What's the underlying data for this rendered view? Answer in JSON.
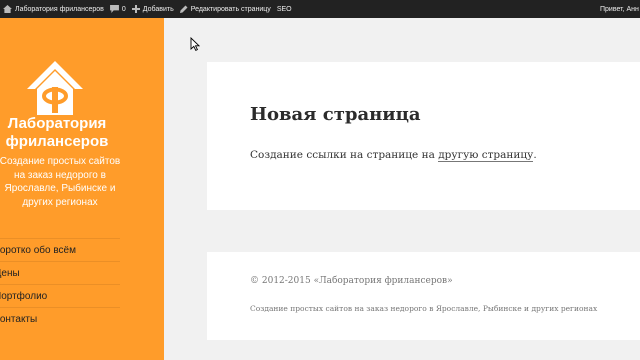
{
  "adminbar": {
    "site_name": "Лаборатория фрилансеров",
    "comments_count": "0",
    "add_label": "Добавить",
    "edit_label": "Редактировать страницу",
    "seo_label": "SEO",
    "greeting": "Привет, Анн"
  },
  "sidebar": {
    "title_line1": "Лаборатория",
    "title_line2": "фрилансеров",
    "description": "Создание простых сайтов на заказ недорого в Ярославле, Рыбинске и других регионах",
    "menu": [
      {
        "label": "Коротко обо всём"
      },
      {
        "label": "Цены"
      },
      {
        "label": "Портфолио"
      },
      {
        "label": "Контакты"
      }
    ]
  },
  "post": {
    "title": "Новая страница",
    "text_before": "Создание ссылки на странице на ",
    "link_text": "другую страницу",
    "text_after": "."
  },
  "footer": {
    "copyright": "© 2012-2015 «Лаборатория фрилансеров»",
    "description": "Создание простых сайтов на заказ недорого в Ярославле, Рыбинске и других регионах"
  },
  "colors": {
    "sidebar_bg": "#ff9c2a",
    "adminbar_bg": "#222222",
    "content_bg": "#f1f1f1"
  }
}
